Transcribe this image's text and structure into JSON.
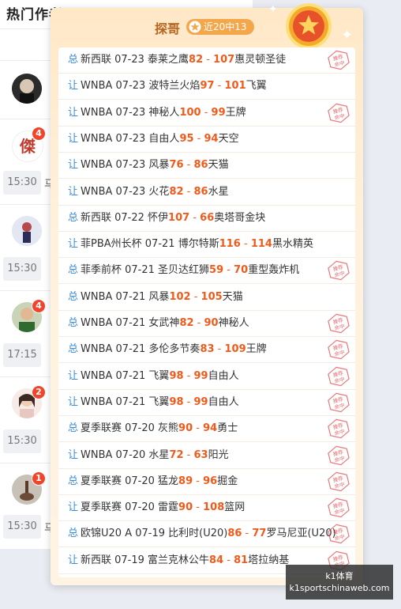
{
  "background": {
    "section_title": "热门作者",
    "cards": [
      {
        "badge": "",
        "time": "",
        "tail": ""
      },
      {
        "badge": "4",
        "time": "15:30",
        "tail": "马"
      },
      {
        "badge": "",
        "time": "15:30",
        "tail": ""
      },
      {
        "badge": "4",
        "time": "17:15",
        "tail": ""
      },
      {
        "badge": "2",
        "time": "15:30",
        "tail": ""
      },
      {
        "badge": "1",
        "time": "15:30",
        "tail": "马"
      }
    ]
  },
  "popup": {
    "title": "探哥",
    "streak": "近20中13",
    "stamp_text": "推荐命中",
    "colors": {
      "score": "#f05a1a",
      "tag": "#3b8bd8",
      "stamp": "#e3484b",
      "pill": "#f4a64a"
    },
    "records": [
      {
        "tag": "总",
        "text": "新西联 07-23 泰莱之鹰",
        "home": "82",
        "away": "107",
        "opp": "惠灵顿圣徒",
        "hit": true
      },
      {
        "tag": "让",
        "text": "WNBA 07-23 波特兰火焰",
        "home": "97",
        "away": "101",
        "opp": "飞翼",
        "hit": false
      },
      {
        "tag": "让",
        "text": "WNBA 07-23 神秘人",
        "home": "100",
        "away": "99",
        "opp": "王牌",
        "hit": true
      },
      {
        "tag": "让",
        "text": "WNBA 07-23 自由人",
        "home": "95",
        "away": "94",
        "opp": "天空",
        "hit": false
      },
      {
        "tag": "让",
        "text": "WNBA 07-23 风暴",
        "home": "76",
        "away": "86",
        "opp": "天猫",
        "hit": false
      },
      {
        "tag": "让",
        "text": "WNBA 07-23 火花",
        "home": "82",
        "away": "86",
        "opp": "水星",
        "hit": false
      },
      {
        "tag": "总",
        "text": "新西联 07-22 怀伊",
        "home": "107",
        "away": "66",
        "opp": "奥塔哥金块",
        "hit": false
      },
      {
        "tag": "让",
        "text": "菲PBA州长杯 07-21 博尔特斯",
        "home": "116",
        "away": "114",
        "opp": "黑水精英",
        "hit": false
      },
      {
        "tag": "总",
        "text": "菲季前杯 07-21 圣贝达红狮",
        "home": "59",
        "away": "70",
        "opp": "重型轰炸机",
        "hit": true
      },
      {
        "tag": "总",
        "text": "WNBA 07-21 风暴",
        "home": "102",
        "away": "105",
        "opp": "天猫",
        "hit": false
      },
      {
        "tag": "总",
        "text": "WNBA 07-21 女武神",
        "home": "82",
        "away": "90",
        "opp": "神秘人",
        "hit": true
      },
      {
        "tag": "总",
        "text": "WNBA 07-21 多伦多节奏",
        "home": "83",
        "away": "109",
        "opp": "王牌",
        "hit": true
      },
      {
        "tag": "让",
        "text": "WNBA 07-21 飞翼",
        "home": "98",
        "away": "99",
        "opp": "自由人",
        "hit": true
      },
      {
        "tag": "让",
        "text": "WNBA 07-21 飞翼",
        "home": "98",
        "away": "99",
        "opp": "自由人",
        "hit": true
      },
      {
        "tag": "总",
        "text": "夏季联赛 07-20 灰熊",
        "home": "90",
        "away": "94",
        "opp": "勇士",
        "hit": true
      },
      {
        "tag": "让",
        "text": "WNBA 07-20 水星",
        "home": "72",
        "away": "63",
        "opp": "阳光",
        "hit": true
      },
      {
        "tag": "总",
        "text": "夏季联赛 07-20 猛龙",
        "home": "89",
        "away": "96",
        "opp": "掘金",
        "hit": true
      },
      {
        "tag": "让",
        "text": "夏季联赛 07-20 雷霆",
        "home": "90",
        "away": "108",
        "opp": "篮网",
        "hit": true
      },
      {
        "tag": "总",
        "text": "欧锦U20 A 07-19 比利时(U20)",
        "home": "86",
        "away": "77",
        "opp": "罗马尼亚(U20)",
        "hit": true
      },
      {
        "tag": "让",
        "text": "新西联 07-19 富兰克林公牛",
        "home": "84",
        "away": "81",
        "opp": "塔拉纳基",
        "hit": true
      }
    ]
  },
  "watermark": {
    "line1": "k1体育",
    "line2": "k1sportschinaweb.com"
  }
}
